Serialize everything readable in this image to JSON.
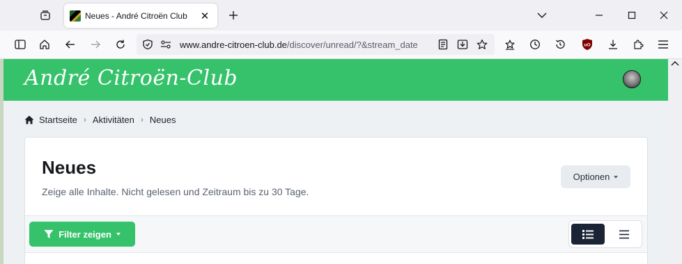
{
  "browser": {
    "tab": {
      "title": "Neues - André Citroën Club",
      "favicon": "club-favicon"
    },
    "url": {
      "host": "www.andre-citroen-club.de",
      "path": "/discover/unread/?&stream_date"
    }
  },
  "site": {
    "logo_text": "André Citroën-Club",
    "brand_color": "#35c26a"
  },
  "breadcrumb": {
    "home": "Startseite",
    "level2": "Aktivitäten",
    "level3": "Neues"
  },
  "page": {
    "title": "Neues",
    "subtitle": "Zeige alle Inhalte. Nicht gelesen und Zeitraum bis zu 30 Tage.",
    "options_label": "Optionen",
    "filter_label": "Filter zeigen"
  }
}
